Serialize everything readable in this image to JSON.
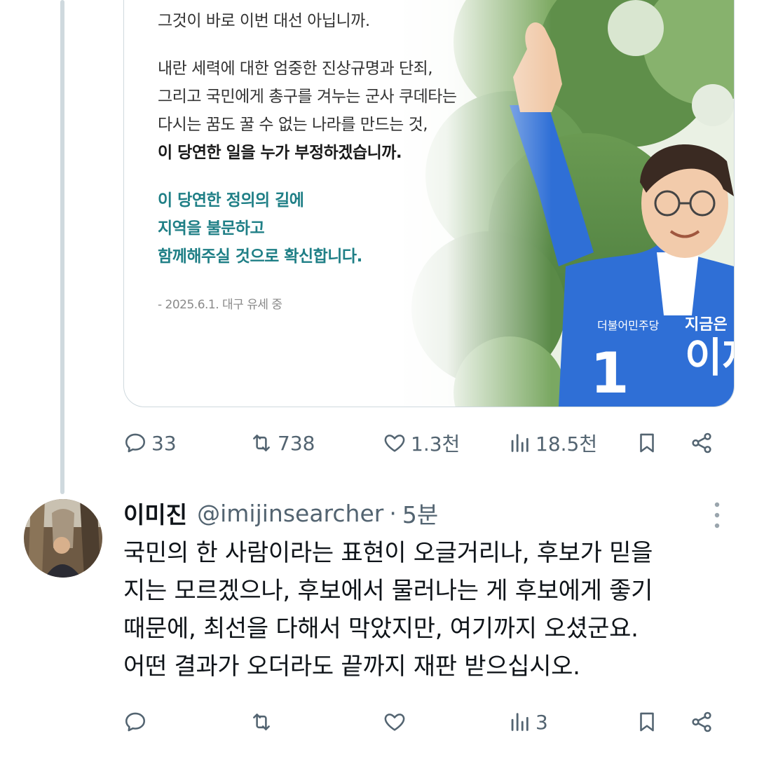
{
  "card": {
    "lines": [
      "그것이 바로 이번 대선 아닙니까.",
      "내란 세력에 대한 엄중한 진상규명과 단죄,",
      "그리고 국민에게 총구를 겨누는 군사 쿠데타는",
      "다시는 꿈도 꿀 수 없는 나라를 만드는 것,",
      "이 당연한 일을 누가 부정하겠습니까."
    ],
    "highlight": [
      "이 당연한 정의의 길에",
      "지역을 불문하고",
      "함께해주실 것으로 확신합니다."
    ],
    "source": "- 2025.6.1. 대구 유세 중",
    "photo_text": {
      "vertical_name": "이재",
      "slogan": "지금은",
      "badge": "더불어민주당",
      "number": "1"
    }
  },
  "post_actions": {
    "replies": "33",
    "reposts": "738",
    "likes": "1.3천",
    "views": "18.5천"
  },
  "reply": {
    "name": "이미진",
    "handle": "@imijinsearcher",
    "separator": "·",
    "time": "5분",
    "body": [
      "국민의 한 사람이라는 표현이 오글거리나, 후보가 믿을",
      "지는 모르겠으나, 후보에서 물러나는 게 후보에게 좋기",
      "때문에, 최선을 다해서 막았지만, 여기까지 오셨군요.",
      "어떤 결과가 오더라도 끝까지 재판 받으십시오."
    ],
    "actions": {
      "views": "3"
    }
  },
  "colors": {
    "icon": "#536471",
    "border": "#cfd9de",
    "teal": "#1f7f86",
    "jacket": "#2f6fd6"
  }
}
